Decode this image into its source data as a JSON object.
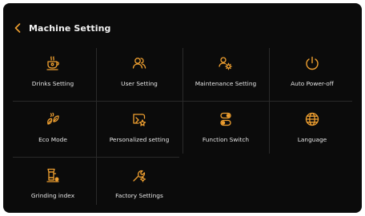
{
  "header": {
    "title": "Machine Setting",
    "back_icon": "chevron-left-icon"
  },
  "colors": {
    "accent": "#f0a030",
    "background": "#0b0b0b",
    "text": "#e6e6e6",
    "divider": "#2a2a2a"
  },
  "menu": {
    "items": [
      {
        "label": "Drinks Setting",
        "icon": "coffee-cup-icon"
      },
      {
        "label": "User Setting",
        "icon": "users-icon"
      },
      {
        "label": "Maintenance Setting",
        "icon": "maintenance-gear-icon"
      },
      {
        "label": "Auto Power-off",
        "icon": "power-icon"
      },
      {
        "label": "Eco Mode",
        "icon": "eco-leaf-icon"
      },
      {
        "label": "Personalized setting",
        "icon": "personalize-sparkle-icon"
      },
      {
        "label": "Function Switch",
        "icon": "toggle-switch-icon"
      },
      {
        "label": "Language",
        "icon": "globe-icon"
      },
      {
        "label": "Grinding index",
        "icon": "grinder-icon"
      },
      {
        "label": "Factory Settings",
        "icon": "wrench-gear-icon"
      }
    ]
  }
}
